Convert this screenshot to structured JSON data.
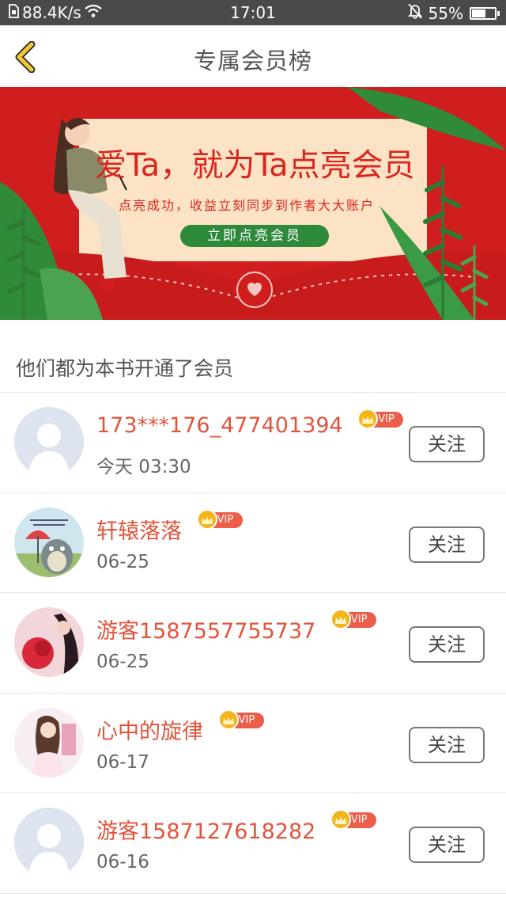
{
  "status_bar": {
    "network_speed": "88.4K/s",
    "time": "17:01",
    "battery_percent": "55%",
    "battery_level": 0.55
  },
  "header": {
    "title": "专属会员榜",
    "back_icon": "chevron-left-icon"
  },
  "banner": {
    "title": "爱Ta，就为Ta点亮会员",
    "subtitle": "点亮成功，收益立刻同步到作者大大账户",
    "button_label": "立即点亮会员",
    "colors": {
      "background": "#d01e1e",
      "card": "#fde3c6",
      "button": "#2c8a3a"
    }
  },
  "section": {
    "title": "他们都为本书开通了会员"
  },
  "members": [
    {
      "name": "173***176_477401394",
      "date": "今天 03:30",
      "badge": "VIP",
      "follow_label": "关注",
      "avatar": "default-avatar"
    },
    {
      "name": "轩辕落落",
      "date": "06-25",
      "badge": "VIP",
      "follow_label": "关注",
      "avatar": "anime-totoro-avatar"
    },
    {
      "name": "游客1587557755737",
      "date": "06-25",
      "badge": "VIP",
      "follow_label": "关注",
      "avatar": "red-flower-avatar"
    },
    {
      "name": "心中的旋律",
      "date": "06-17",
      "badge": "VIP",
      "follow_label": "关注",
      "avatar": "girl-illustration-avatar"
    },
    {
      "name": "游客1587127618282",
      "date": "06-16",
      "badge": "VIP",
      "follow_label": "关注",
      "avatar": "default-avatar"
    }
  ],
  "accent_colors": {
    "name": "#e2543a",
    "vip_pill": "#ec5d4a",
    "crown": "#f4b519"
  }
}
